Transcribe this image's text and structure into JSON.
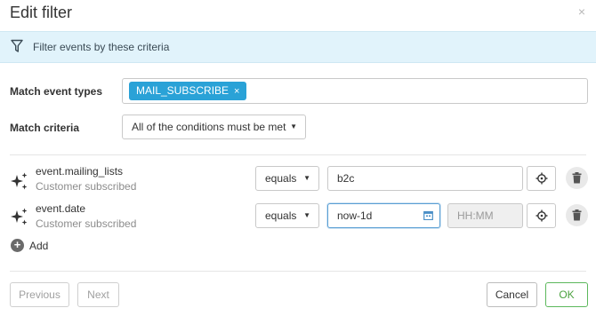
{
  "dialog": {
    "title": "Edit filter",
    "close_glyph": "×"
  },
  "banner": {
    "icon": "filter-icon",
    "text": "Filter events by these criteria"
  },
  "match_event_types": {
    "label": "Match event types",
    "tags": [
      {
        "label": "MAIL_SUBSCRIBE",
        "remove_glyph": "×"
      }
    ],
    "tag_color": "#2aa2d7"
  },
  "match_criteria": {
    "label": "Match criteria",
    "selected": "All of the conditions must be met"
  },
  "conditions": [
    {
      "icon": "sparkle-icon",
      "field": "event.mailing_lists",
      "description": "Customer subscribed",
      "operator": "equals",
      "value": "b2c"
    },
    {
      "icon": "sparkle-icon",
      "field": "event.date",
      "description": "Customer subscribed",
      "operator": "equals",
      "value": "now-1d",
      "time_placeholder": "HH:MM"
    }
  ],
  "add": {
    "glyph": "+",
    "label": "Add"
  },
  "footer": {
    "previous_label": "Previous",
    "next_label": "Next",
    "cancel_label": "Cancel",
    "ok_label": "OK",
    "ok_color": "#5cb85c"
  }
}
